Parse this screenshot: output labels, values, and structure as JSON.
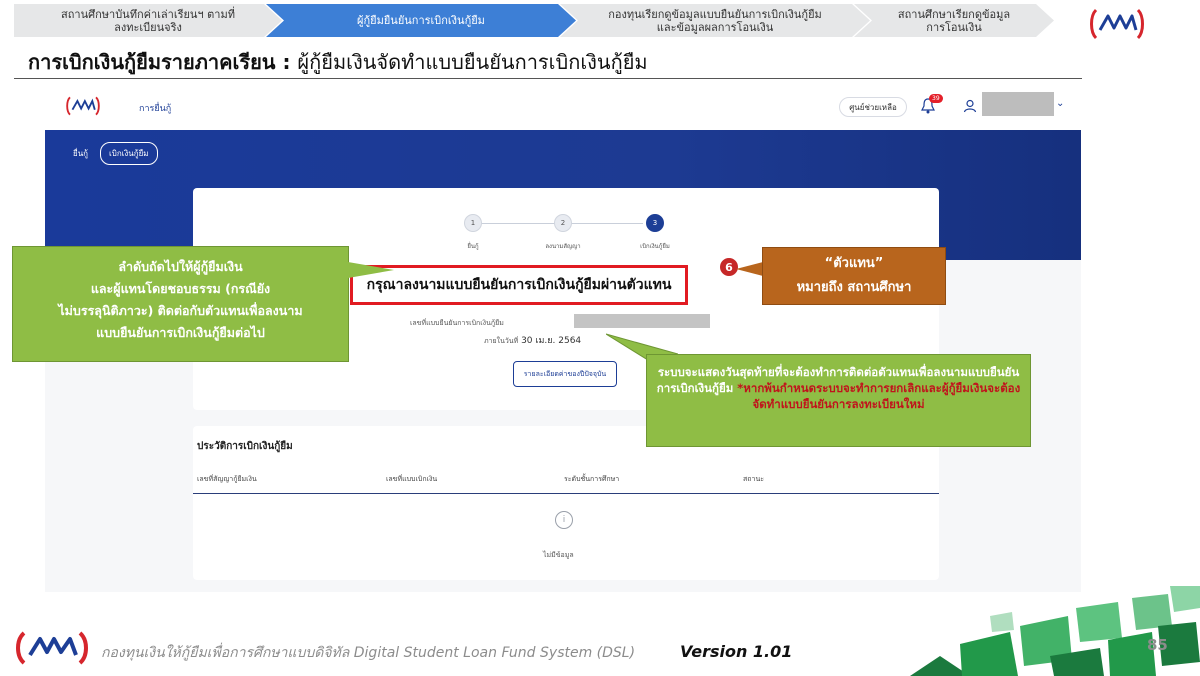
{
  "process_steps": [
    {
      "label_line1": "สถานศึกษาบันทึกค่าเล่าเรียนฯ ตามที่",
      "label_line2": "ลงทะเบียนจริง"
    },
    {
      "label_line1": "ผู้กู้ยืมยืนยันการเบิกเงินกู้ยืม",
      "label_line2": ""
    },
    {
      "label_line1": "กองทุนเรียกดูข้อมูลแบบยืนยันการเบิกเงินกู้ยืม",
      "label_line2": "และข้อมูลผลการโอนเงิน"
    },
    {
      "label_line1": "สถานศึกษาเรียกดูข้อมูล",
      "label_line2": "การโอนเงิน"
    }
  ],
  "slide_title": {
    "main": "การเบิกเงินกู้ยืมรายภาคเรียน",
    "separator": ":",
    "sub": "ผู้กู้ยืมเงินจัดทำแบบยืนยันการเบิกเงินกู้ยืม"
  },
  "app": {
    "nav_item": "การยื่นกู้",
    "help_button": "ศูนย์ช่วยเหลือ",
    "notification_count": "39",
    "tabs": [
      {
        "label": "ยื่นกู้",
        "active": false
      },
      {
        "label": "เบิกเงินกู้ยืม",
        "active": true
      }
    ],
    "stepper": [
      {
        "num": "1",
        "label": "ยื่นกู้",
        "active": false
      },
      {
        "num": "2",
        "label": "ลงนามสัญญา",
        "active": false
      },
      {
        "num": "3",
        "label": "เบิกเงินกู้ยืม",
        "active": true
      }
    ],
    "headline": "กรุณาลงนามแบบยืนยันการเบิกเงินกู้ยืมผ่านตัวแทน",
    "doc_number_label": "เลขที่แบบยืนยันการเบิกเงินกู้ยืม",
    "deadline_label": "ภายในวันที่",
    "deadline_value": "30 เม.ย. 2564",
    "detail_button": "รายละเอียดค่าของปีปัจจุบัน",
    "history_title": "ประวัติการเบิกเงินกู้ยืม",
    "history_columns": [
      "เลขที่สัญญากู้ยืมเงิน",
      "เลขที่แบบเบิกเงิน",
      "ระดับชั้นการศึกษา",
      "สถานะ"
    ],
    "empty_text": "ไม่มีข้อมูล",
    "empty_icon": "info-icon"
  },
  "callouts": {
    "left": [
      "ลำดับถัดไปให้ผู้กู้ยืมเงิน",
      "และผู้แทนโดยชอบธรรม (กรณียัง",
      "ไม่บรรลุนิติภาวะ) ติดต่อกับตัวแทนเพื่อลงนาม",
      "แบบยืนยันการเบิกเงินกู้ยืมต่อไป"
    ],
    "badge": "6",
    "right_line1": "“ตัวแทน”",
    "right_line2": "หมายถึง สถานศึกษา",
    "bottom_normal": "ระบบจะแสดงวันสุดท้ายที่จะต้องทำการติดต่อตัวแทนเพื่อลงนามแบบยืนยันการเบิกเงินกู้ยืม ",
    "bottom_red": "*หากพ้นกำหนดระบบจะทำการยกเลิกและผู้กู้ยืมเงินจะต้องจัดทำแบบยืนยันการลงทะเบียนใหม่"
  },
  "footer": {
    "text": "กองทุนเงินให้กู้ยืมเพื่อการศึกษาแบบดิจิทัล Digital Student Loan Fund System (DSL)",
    "version": "Version 1.01",
    "page": "85"
  },
  "colors": {
    "active_step": "#3d7fd6",
    "hero_blue": "#1a3a9a",
    "callout_green": "#8fbd45",
    "callout_brown": "#b8651d",
    "highlight_red": "#e11b22"
  }
}
